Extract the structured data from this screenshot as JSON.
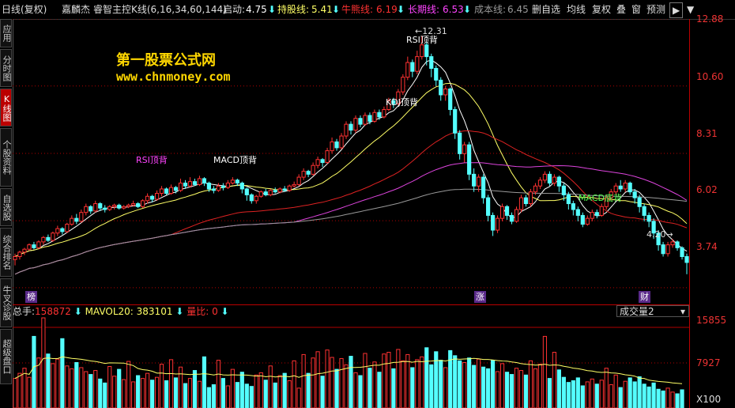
{
  "header": {
    "period": "日线(复权)",
    "stock_name": "嘉麟杰",
    "indicator": "睿智主控K线(6,16,34,60,144)",
    "start_label": "启动:",
    "start_value": "4.75",
    "hold_label": "持股线:",
    "hold_value": "5.41",
    "bull_label": "牛熊线:",
    "bull_value": "6.19",
    "long_label": "长期线:",
    "long_value": "6.53",
    "cost_label": "成本线:",
    "cost_value": "6.45",
    "buttons": [
      "删自选",
      "均线",
      "复权",
      "叠",
      "窗",
      "预测"
    ],
    "arrow": "⬇",
    "nav_icon": "▶",
    "menu_icon": "▼"
  },
  "sidebar": {
    "tabs": [
      "应用",
      "分时图",
      "K线图",
      "个股资料",
      "自选股",
      "综合排名",
      "牛叉诊股",
      "超级盘口"
    ]
  },
  "watermark": {
    "line1": "第一股票公式网",
    "line2": "www.chnmoney.com"
  },
  "annotations": {
    "rsi_top_left": "RSI顶背",
    "macd_top": "MACD顶背",
    "kdj_top": "KDJ顶背",
    "rsi_top_peak": "RSI顶背",
    "macd_bottom": "MACD底背",
    "peak_price": "12.31",
    "low_price": "4.20",
    "mark_left": "榜",
    "mark_mid": "涨",
    "mark_right": "财"
  },
  "price_axis": {
    "ticks": [
      "12.88",
      "10.60",
      "8.31",
      "6.02",
      "3.74"
    ]
  },
  "volume": {
    "total_label": "总手:",
    "total_value": "158872",
    "mavol_label": "MAVOL20:",
    "mavol_value": "383101",
    "ratio_label": "量比:",
    "ratio_value": "0",
    "selector": "成交量2",
    "ticks": [
      "15855",
      "7927",
      "X100"
    ]
  },
  "colors": {
    "up": "#ff3232",
    "down": "#54ffff",
    "yellow": "#ffd700",
    "grid": "#b00000",
    "ma_white": "#ffffff",
    "ma_yellow": "#ffff66",
    "ma_red": "#dd2222",
    "ma_magenta": "#dd44dd",
    "ma_gray": "#999999"
  },
  "chart_data": {
    "type": "candlestick",
    "title": "",
    "xlabel": "",
    "ylabel": "",
    "ylim": [
      3.2,
      12.88
    ],
    "volume_ylim": [
      0,
      15855
    ],
    "candles": [
      [
        4.7,
        4.8,
        4.5,
        4.9
      ],
      [
        4.8,
        4.95,
        4.7,
        5.0
      ],
      [
        4.95,
        5.05,
        4.85,
        5.1
      ],
      [
        5.05,
        5.2,
        5.0,
        5.25
      ],
      [
        5.2,
        5.1,
        5.05,
        5.3
      ],
      [
        5.1,
        5.3,
        5.05,
        5.35
      ],
      [
        5.3,
        5.45,
        5.2,
        5.5
      ],
      [
        5.45,
        5.35,
        5.3,
        5.55
      ],
      [
        5.35,
        5.6,
        5.3,
        5.65
      ],
      [
        5.6,
        5.75,
        5.5,
        5.85
      ],
      [
        5.75,
        5.65,
        5.55,
        5.8
      ],
      [
        5.65,
        5.9,
        5.6,
        5.95
      ],
      [
        5.9,
        6.1,
        5.85,
        6.2
      ],
      [
        6.1,
        6.0,
        5.9,
        6.25
      ],
      [
        6.0,
        6.3,
        5.95,
        6.4
      ],
      [
        6.3,
        6.5,
        6.2,
        6.6
      ],
      [
        6.5,
        6.35,
        6.25,
        6.55
      ],
      [
        6.35,
        6.6,
        6.3,
        6.7
      ],
      [
        6.6,
        6.45,
        6.35,
        6.65
      ],
      [
        6.45,
        6.4,
        6.3,
        6.55
      ],
      [
        6.4,
        6.5,
        6.35,
        6.55
      ],
      [
        6.5,
        6.55,
        6.4,
        6.6
      ],
      [
        6.55,
        6.45,
        6.4,
        6.6
      ],
      [
        6.45,
        6.5,
        6.4,
        6.55
      ],
      [
        6.5,
        6.55,
        6.45,
        6.6
      ],
      [
        6.55,
        6.6,
        6.5,
        6.7
      ],
      [
        6.6,
        6.5,
        6.45,
        6.65
      ],
      [
        6.5,
        6.7,
        6.45,
        6.75
      ],
      [
        6.7,
        6.85,
        6.6,
        6.95
      ],
      [
        6.85,
        6.75,
        6.65,
        6.9
      ],
      [
        6.75,
        6.95,
        6.7,
        7.05
      ],
      [
        6.95,
        7.1,
        6.85,
        7.2
      ],
      [
        7.1,
        6.95,
        6.9,
        7.15
      ],
      [
        6.95,
        7.15,
        6.9,
        7.25
      ],
      [
        7.15,
        7.05,
        6.95,
        7.2
      ],
      [
        7.05,
        7.3,
        7.0,
        7.45
      ],
      [
        7.3,
        7.2,
        7.1,
        7.4
      ],
      [
        7.2,
        7.35,
        7.15,
        7.5
      ],
      [
        7.35,
        7.25,
        7.2,
        7.45
      ],
      [
        7.25,
        7.45,
        7.2,
        7.55
      ],
      [
        7.45,
        7.3,
        7.2,
        7.5
      ],
      [
        7.3,
        7.1,
        7.0,
        7.35
      ],
      [
        7.1,
        7.05,
        6.95,
        7.2
      ],
      [
        7.05,
        7.2,
        7.0,
        7.3
      ],
      [
        7.2,
        7.15,
        7.05,
        7.3
      ],
      [
        7.15,
        7.3,
        7.1,
        7.4
      ],
      [
        7.3,
        7.4,
        7.25,
        7.5
      ],
      [
        7.4,
        7.3,
        7.2,
        7.45
      ],
      [
        7.3,
        7.1,
        6.95,
        7.35
      ],
      [
        7.1,
        6.9,
        6.7,
        7.15
      ],
      [
        6.9,
        6.7,
        6.6,
        6.95
      ],
      [
        6.7,
        6.85,
        6.6,
        6.9
      ],
      [
        6.85,
        7.0,
        6.8,
        7.05
      ],
      [
        7.0,
        6.9,
        6.85,
        7.1
      ],
      [
        6.9,
        7.05,
        6.85,
        7.1
      ],
      [
        7.05,
        7.0,
        6.95,
        7.15
      ],
      [
        7.0,
        7.1,
        6.95,
        7.15
      ],
      [
        7.1,
        7.05,
        7.0,
        7.2
      ],
      [
        7.05,
        7.2,
        7.0,
        7.25
      ],
      [
        7.2,
        7.25,
        7.15,
        7.35
      ],
      [
        7.25,
        7.5,
        7.2,
        7.6
      ],
      [
        7.5,
        7.7,
        7.4,
        7.8
      ],
      [
        7.7,
        7.6,
        7.5,
        7.75
      ],
      [
        7.6,
        7.9,
        7.55,
        8.0
      ],
      [
        7.9,
        8.1,
        7.8,
        8.2
      ],
      [
        8.1,
        8.0,
        7.85,
        8.15
      ],
      [
        8.0,
        8.4,
        7.95,
        8.5
      ],
      [
        8.4,
        8.7,
        8.3,
        8.85
      ],
      [
        8.7,
        8.5,
        8.4,
        8.8
      ],
      [
        8.5,
        8.9,
        8.45,
        9.0
      ],
      [
        8.9,
        9.3,
        8.8,
        9.4
      ],
      [
        9.3,
        9.1,
        8.95,
        9.4
      ],
      [
        9.1,
        9.5,
        9.0,
        9.6
      ],
      [
        9.5,
        9.3,
        9.2,
        9.6
      ],
      [
        9.3,
        9.6,
        9.25,
        9.7
      ],
      [
        9.6,
        9.4,
        9.3,
        9.7
      ],
      [
        9.4,
        9.7,
        9.35,
        9.8
      ],
      [
        9.7,
        9.55,
        9.45,
        9.8
      ],
      [
        9.55,
        9.8,
        9.5,
        9.9
      ],
      [
        9.8,
        10.1,
        9.75,
        10.2
      ],
      [
        10.1,
        10.0,
        9.85,
        10.2
      ],
      [
        10.0,
        10.4,
        9.95,
        10.5
      ],
      [
        10.4,
        10.9,
        10.3,
        11.0
      ],
      [
        10.9,
        11.4,
        10.8,
        11.6
      ],
      [
        11.4,
        11.1,
        10.9,
        11.5
      ],
      [
        11.1,
        11.6,
        11.0,
        11.8
      ],
      [
        11.6,
        12.0,
        11.5,
        12.31
      ],
      [
        12.0,
        11.6,
        11.3,
        12.1
      ],
      [
        11.6,
        11.2,
        10.9,
        11.7
      ],
      [
        11.2,
        10.8,
        10.6,
        11.3
      ],
      [
        10.8,
        10.3,
        10.1,
        10.9
      ],
      [
        10.3,
        10.5,
        10.1,
        10.6
      ],
      [
        10.5,
        9.8,
        9.6,
        10.55
      ],
      [
        9.8,
        9.0,
        8.8,
        9.9
      ],
      [
        9.0,
        8.3,
        8.1,
        9.1
      ],
      [
        8.3,
        8.6,
        8.0,
        8.7
      ],
      [
        8.6,
        7.6,
        7.4,
        8.7
      ],
      [
        7.6,
        7.2,
        7.0,
        7.8
      ],
      [
        7.2,
        7.5,
        7.0,
        7.6
      ],
      [
        7.5,
        6.8,
        6.6,
        7.6
      ],
      [
        6.8,
        6.2,
        6.0,
        6.9
      ],
      [
        6.2,
        5.7,
        5.5,
        6.3
      ],
      [
        5.7,
        6.1,
        5.6,
        6.2
      ],
      [
        6.1,
        6.5,
        6.0,
        6.6
      ],
      [
        6.5,
        6.2,
        6.05,
        6.55
      ],
      [
        6.2,
        6.0,
        5.9,
        6.3
      ],
      [
        6.0,
        6.4,
        5.95,
        6.5
      ],
      [
        6.4,
        6.8,
        6.3,
        6.9
      ],
      [
        6.8,
        6.6,
        6.5,
        6.9
      ],
      [
        6.6,
        7.0,
        6.5,
        7.1
      ],
      [
        7.0,
        7.2,
        6.9,
        7.3
      ],
      [
        7.2,
        7.4,
        7.1,
        7.5
      ],
      [
        7.4,
        7.6,
        7.3,
        7.7
      ],
      [
        7.6,
        7.3,
        7.2,
        7.7
      ],
      [
        7.3,
        7.5,
        7.2,
        7.6
      ],
      [
        7.5,
        7.2,
        7.0,
        7.55
      ],
      [
        7.2,
        6.9,
        6.7,
        7.3
      ],
      [
        6.9,
        6.6,
        6.4,
        7.0
      ],
      [
        6.6,
        6.4,
        6.2,
        6.7
      ],
      [
        6.4,
        6.2,
        6.0,
        6.5
      ],
      [
        6.2,
        5.9,
        5.8,
        6.3
      ],
      [
        5.9,
        6.1,
        5.85,
        6.2
      ],
      [
        6.1,
        6.3,
        6.0,
        6.4
      ],
      [
        6.3,
        6.2,
        6.1,
        6.4
      ],
      [
        6.2,
        6.5,
        6.15,
        6.6
      ],
      [
        6.5,
        6.8,
        6.4,
        6.9
      ],
      [
        6.8,
        7.0,
        6.7,
        7.1
      ],
      [
        7.0,
        7.2,
        6.9,
        7.3
      ],
      [
        7.2,
        7.1,
        7.0,
        7.4
      ],
      [
        7.1,
        7.3,
        7.0,
        7.4
      ],
      [
        7.3,
        7.0,
        6.9,
        7.35
      ],
      [
        7.0,
        6.8,
        6.6,
        7.1
      ],
      [
        6.8,
        6.5,
        6.3,
        6.9
      ],
      [
        6.5,
        6.2,
        6.0,
        6.6
      ],
      [
        6.2,
        6.0,
        5.8,
        6.3
      ],
      [
        6.0,
        5.6,
        5.4,
        6.1
      ],
      [
        5.6,
        5.2,
        5.0,
        5.7
      ],
      [
        5.2,
        4.9,
        4.8,
        5.3
      ],
      [
        4.9,
        5.2,
        4.8,
        5.3
      ],
      [
        5.2,
        5.3,
        5.1,
        5.4
      ],
      [
        5.3,
        5.1,
        5.0,
        5.35
      ],
      [
        5.1,
        4.8,
        4.7,
        5.15
      ],
      [
        4.8,
        4.6,
        4.2,
        4.9
      ]
    ],
    "volumes": [
      5200,
      6100,
      7000,
      5400,
      12600,
      8800,
      15855,
      9500,
      7800,
      8600,
      12200,
      7400,
      6900,
      8000,
      7100,
      6400,
      5900,
      6600,
      5100,
      4400,
      7300,
      5600,
      6800,
      5000,
      8200,
      4600,
      5700,
      5200,
      6100,
      4900,
      5400,
      7700,
      4800,
      8500,
      5300,
      7200,
      4300,
      5200,
      6600,
      4700,
      9000,
      3600,
      4100,
      8400,
      5200,
      3900,
      6800,
      4500,
      6300,
      4200,
      3800,
      5800,
      6200,
      4900,
      7400,
      4400,
      5700,
      6100,
      4800,
      8300,
      3500,
      9400,
      6100,
      8800,
      9900,
      5600,
      10200,
      8900,
      6800,
      8700,
      7600,
      9100,
      6200,
      5700,
      9600,
      7000,
      8100,
      6300,
      9500,
      9800,
      6900,
      10300,
      8300,
      9400,
      7100,
      8500,
      9000,
      10600,
      7600,
      9900,
      8400,
      7100,
      10100,
      9200,
      8300,
      8000,
      8800,
      7500,
      8600,
      7200,
      6900,
      8400,
      6400,
      7800,
      6300,
      5900,
      7000,
      6600,
      5800,
      8300,
      6900,
      7700,
      12600,
      5200,
      9800,
      6700,
      5400,
      4500,
      4800,
      5300,
      3900,
      4600,
      5100,
      4200,
      4900,
      7000,
      4100,
      5800,
      3600,
      4700,
      5300,
      4600,
      5500,
      4200,
      3700,
      4400,
      3300,
      3000,
      3500,
      2800,
      2500,
      3200
    ]
  }
}
